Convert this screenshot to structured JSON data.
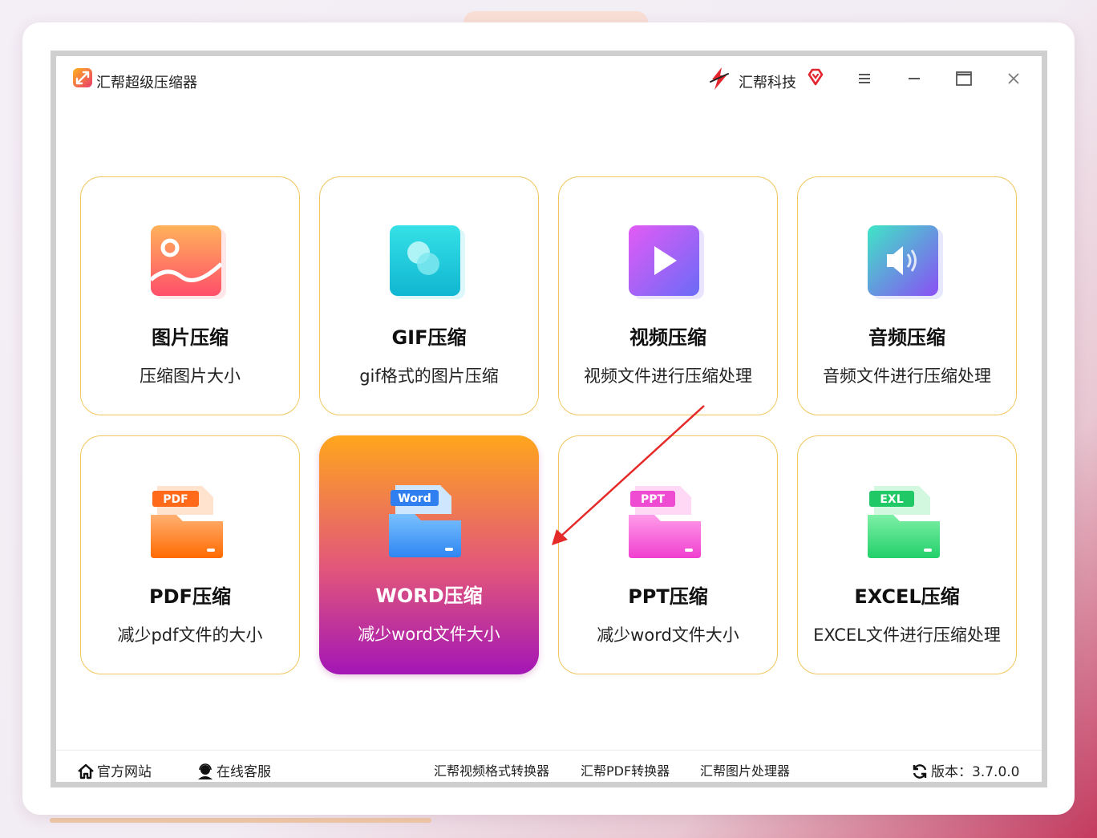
{
  "window": {
    "title": "汇帮超级压缩器",
    "brand": "汇帮科技"
  },
  "tools": [
    {
      "title": "图片压缩",
      "desc": "压缩图片大小",
      "icon": "image-icon"
    },
    {
      "title": "GIF压缩",
      "desc": "gif格式的图片压缩",
      "icon": "gif-icon"
    },
    {
      "title": "视频压缩",
      "desc": "视频文件进行压缩处理",
      "icon": "video-play-icon"
    },
    {
      "title": "音频压缩",
      "desc": "音频文件进行压缩处理",
      "icon": "speaker-icon"
    },
    {
      "title": "PDF压缩",
      "desc": "减少pdf文件的大小",
      "icon": "pdf-folder-icon",
      "badge": "PDF"
    },
    {
      "title": "WORD压缩",
      "desc": "减少word文件大小",
      "icon": "word-folder-icon",
      "badge": "Word",
      "selected": true
    },
    {
      "title": "PPT压缩",
      "desc": "减少word文件大小",
      "icon": "ppt-folder-icon",
      "badge": "PPT"
    },
    {
      "title": "EXCEL压缩",
      "desc": "EXCEL文件进行压缩处理",
      "icon": "excel-folder-icon",
      "badge": "EXL"
    }
  ],
  "footer": {
    "website": "官方网站",
    "support": "在线客服",
    "links": [
      "汇帮视频格式转换器",
      "汇帮PDF转换器",
      "汇帮图片处理器"
    ],
    "version": "版本：3.7.0.0"
  },
  "colors": {
    "card_border": "#f0c65c",
    "active_gradient_top": "#ffa61d",
    "active_gradient_bottom": "#a316b6",
    "annotation_arrow": "#e52a2a"
  }
}
